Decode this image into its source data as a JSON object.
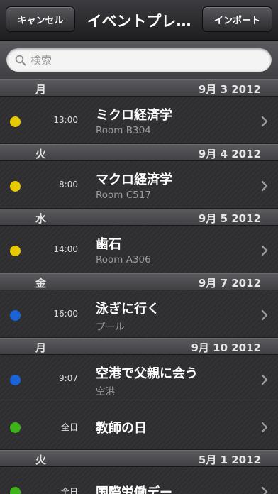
{
  "navbar": {
    "cancel_label": "キャンセル",
    "title": "イベントプレ…",
    "import_label": "インポート"
  },
  "search": {
    "placeholder": "検索",
    "value": ""
  },
  "colors": {
    "yellow": "#e8c800",
    "blue": "#1a63d8",
    "green": "#3bb319"
  },
  "sections": [
    {
      "day": "月",
      "date": "9月 3 2012",
      "events": [
        {
          "time": "13:00",
          "title": "ミクロ経済学",
          "location": "Room B304",
          "color": "yellow"
        }
      ]
    },
    {
      "day": "火",
      "date": "9月 4 2012",
      "events": [
        {
          "time": "8:00",
          "title": "マクロ経済学",
          "location": "Room C517",
          "color": "yellow"
        }
      ]
    },
    {
      "day": "水",
      "date": "9月 5 2012",
      "events": [
        {
          "time": "14:00",
          "title": "歯石",
          "location": "Room A306",
          "color": "yellow"
        }
      ]
    },
    {
      "day": "金",
      "date": "9月 7 2012",
      "events": [
        {
          "time": "16:00",
          "title": "泳ぎに行く",
          "location": "プール",
          "color": "blue"
        }
      ]
    },
    {
      "day": "月",
      "date": "9月 10 2012",
      "events": [
        {
          "time": "9:07",
          "title": "空港で父親に会う",
          "location": "空港",
          "color": "blue"
        },
        {
          "time": "全日",
          "title": "教師の日",
          "location": "",
          "color": "green"
        }
      ]
    },
    {
      "day": "火",
      "date": "5月 1 2012",
      "events": [
        {
          "time": "全日",
          "title": "国際労働デー",
          "location": "",
          "color": "green"
        }
      ]
    }
  ]
}
